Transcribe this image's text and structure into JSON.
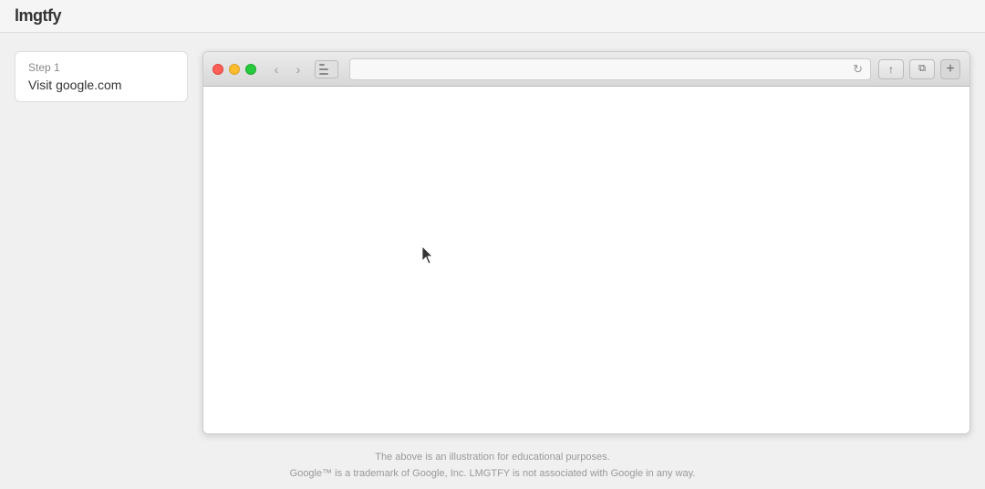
{
  "app": {
    "title": "lmgtfy"
  },
  "steps": [
    {
      "number": "Step 1",
      "label": "Visit google.com"
    }
  ],
  "browser": {
    "url_placeholder": "",
    "back_arrow": "‹",
    "forward_arrow": "›",
    "reload": "↻",
    "share_icon": "↑",
    "copy_icon": "⧉",
    "new_tab": "+"
  },
  "footer": {
    "line1": "The above is an illustration for educational purposes.",
    "line2": "Google™ is a trademark of Google, Inc. LMGTFY is not associated with Google in any way."
  }
}
